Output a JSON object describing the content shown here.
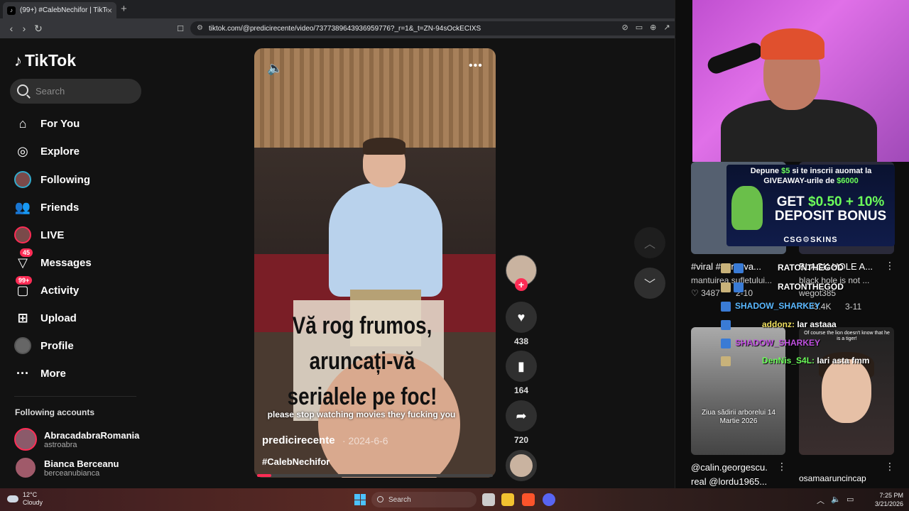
{
  "browser": {
    "tab_title": "(99+) #CalebNechifor | TikTok",
    "tab_close": "×",
    "new_tab": "+",
    "url": "tiktok.com/@predicirecente/video/7377389643936959776?_r=1&_t=ZN-94sOckECIXS"
  },
  "sidebar": {
    "logo": "TikTok",
    "search_placeholder": "Search",
    "nav": [
      {
        "label": "For You",
        "icon": "home-icon"
      },
      {
        "label": "Explore",
        "icon": "compass-icon"
      },
      {
        "label": "Following",
        "icon": "following-avatar-icon"
      },
      {
        "label": "Friends",
        "icon": "friends-icon"
      },
      {
        "label": "LIVE",
        "icon": "live-avatar-icon"
      },
      {
        "label": "Messages",
        "icon": "messages-icon",
        "badge": "45"
      },
      {
        "label": "Activity",
        "icon": "activity-icon",
        "badge": "99+"
      },
      {
        "label": "Upload",
        "icon": "upload-icon"
      },
      {
        "label": "Profile",
        "icon": "profile-avatar-icon"
      },
      {
        "label": "More",
        "icon": "more-icon"
      }
    ],
    "following_title": "Following accounts",
    "accounts": [
      {
        "name": "AbracadabraRomania",
        "handle": "astroabra"
      },
      {
        "name": "Bianca Berceanu",
        "handle": "berceanubianca"
      }
    ]
  },
  "video": {
    "overlay_text": [
      "Vă rog frumos,",
      "aruncați-vă",
      "serialele pe foc!"
    ],
    "subtitle": "please stop watching movies they fucking you",
    "author": "predicirecente",
    "date": "· 2024-6-6",
    "hashtag": "#CalebNechifor",
    "progress": 0.06,
    "likes": "438",
    "saves": "164",
    "shares": "720"
  },
  "stream": {
    "promo_top_1": "Depune ",
    "promo_top_amount": "$5",
    "promo_top_2": " si te inscrii auomat la",
    "promo_top_3": "GIVEAWAY-urile de ",
    "promo_top_amount2": "$6000",
    "promo_big_1": "GET ",
    "promo_big_amount": "$0.50 + 10%",
    "promo_big_2": "DEPOSIT BONUS",
    "promo_brand": "CSG⚙SKINS",
    "grid": [
      {
        "title": "#viral #nervuva...",
        "sub": "mantuirea sufletului...",
        "likes": "3487"
      },
      {
        "title": "BLACK HOLE A...",
        "sub": "black hole is not ...",
        "author": "wegot385",
        "likes": "33.4K"
      },
      {
        "title": "@calin.georgescu.",
        "sub": "real @lordu1965...",
        "caption": "Ziua sădirii arborelui 14 Martie 2026"
      },
      {
        "title": "osamaaruncincap",
        "caption": "Of course the lion doesn't know that he is a tiger!"
      }
    ],
    "chat": [
      {
        "user": "RATONTHEGOD",
        "text": ""
      },
      {
        "user": "RATONTHEGOD",
        "text": ""
      },
      {
        "user": "SHADOW_SHARKEY",
        "text": ""
      },
      {
        "user": "addonz:",
        "text": "Iar astaaa"
      },
      {
        "user": "SHADOW_SHARKEY",
        "text": ""
      },
      {
        "user": "DenNis_S4L:",
        "text": "Iari asta fmm"
      }
    ],
    "partial_date": "2-10",
    "partial_date2": "3-11"
  },
  "taskbar": {
    "temp": "12°C",
    "weather": "Cloudy",
    "search": "Search",
    "time": "7:25 PM",
    "date": "3/21/2026"
  },
  "colors": {
    "accent": "#fe2c55",
    "sidebar_bg": "#121212",
    "promo_green": "#6cff5a"
  }
}
